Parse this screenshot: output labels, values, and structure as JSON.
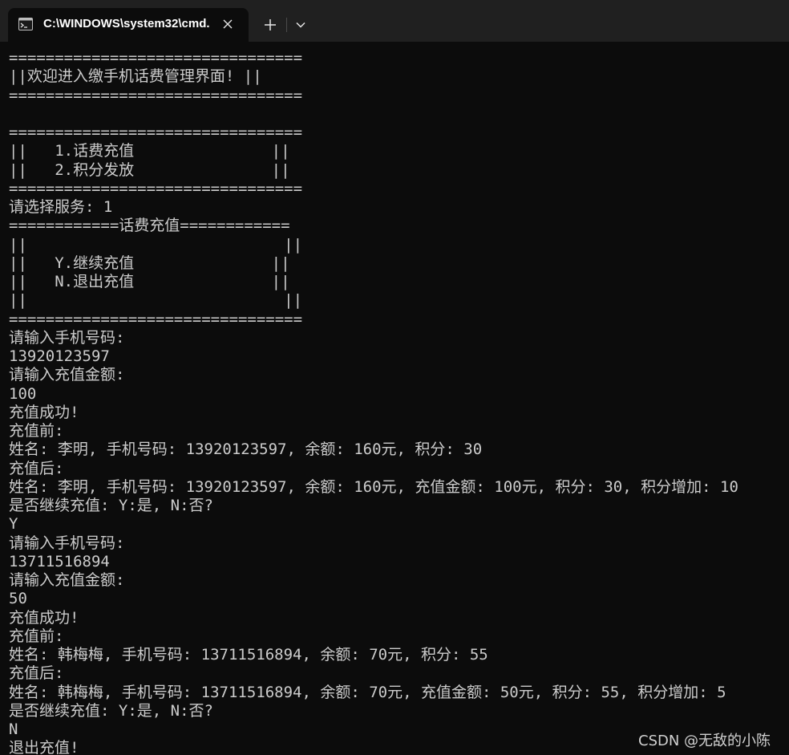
{
  "window": {
    "tab_title": "C:\\WINDOWS\\system32\\cmd.",
    "tab_icon": "console-icon",
    "close_icon": "close-icon",
    "new_tab_icon": "plus-icon",
    "dropdown_icon": "chevron-down-icon"
  },
  "console": {
    "lines": [
      "================================",
      "||欢迎进入缴手机话费管理界面! ||",
      "================================",
      "",
      "================================",
      "||   1.话费充值               ||",
      "||   2.积分发放               ||",
      "================================",
      "请选择服务: 1",
      "============话费充值============",
      "||                            ||",
      "||   Y.继续充值               ||",
      "||   N.退出充值               ||",
      "||                            ||",
      "================================",
      "请输入手机号码:",
      "13920123597",
      "请输入充值金额:",
      "100",
      "充值成功!",
      "充值前:",
      "姓名: 李明, 手机号码: 13920123597, 余额: 160元, 积分: 30",
      "充值后:",
      "姓名: 李明, 手机号码: 13920123597, 余额: 160元, 充值金额: 100元, 积分: 30, 积分增加: 10",
      "是否继续充值: Y:是, N:否?",
      "Y",
      "请输入手机号码:",
      "13711516894",
      "请输入充值金额:",
      "50",
      "充值成功!",
      "充值前:",
      "姓名: 韩梅梅, 手机号码: 13711516894, 余额: 70元, 积分: 55",
      "充值后:",
      "姓名: 韩梅梅, 手机号码: 13711516894, 余额: 70元, 充值金额: 50元, 积分: 55, 积分增加: 5",
      "是否继续充值: Y:是, N:否?",
      "N",
      "退出充值!"
    ]
  },
  "watermark": "CSDN @无敌的小陈",
  "colors": {
    "background": "#0c0c0c",
    "tabbar": "#202020",
    "text": "#cccccc"
  }
}
